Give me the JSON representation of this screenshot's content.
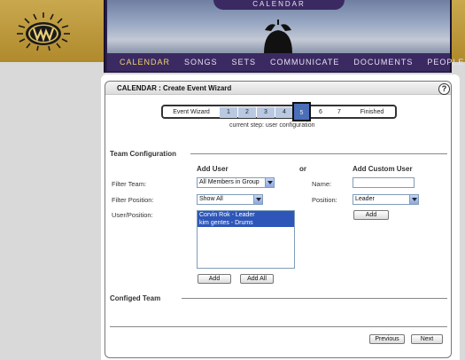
{
  "header": {
    "banner_title": "CALENDAR",
    "nav": [
      "CALENDAR",
      "SONGS",
      "SETS",
      "COMMUNICATE",
      "DOCUMENTS",
      "PEOPLE"
    ],
    "active_nav": "CALENDAR",
    "logo_icon": "w-sunburst-logo-icon",
    "clock_icon": "alarm-clock-icon"
  },
  "wizard": {
    "title": "CALENDAR : Create Event Wizard",
    "help": "?",
    "steps_label": "Event Wizard",
    "steps": [
      "1",
      "2",
      "3",
      "4",
      "5",
      "6",
      "7"
    ],
    "current_step_number": "5",
    "finished": "Finished",
    "current_step_text": "current step: user configuration"
  },
  "team_config": {
    "title": "Team Configuration",
    "add_user_head": "Add User",
    "or": "or",
    "add_custom_head": "Add Custom User",
    "filter_team_label": "Filter Team:",
    "filter_team_value": "All Members in Group",
    "filter_position_label": "Filter Position:",
    "filter_position_value": "Show All",
    "user_position_label": "User/Position:",
    "users": [
      "Corvin Rok - Leader",
      "kim gentes - Drums"
    ],
    "name_label": "Name:",
    "name_value": "",
    "position_label": "Position:",
    "position_value": "Leader",
    "add_custom_button": "Add",
    "add_button": "Add",
    "add_all_button": "Add All"
  },
  "configed_team": {
    "title": "Configed Team"
  },
  "footer": {
    "previous": "Previous",
    "next": "Next"
  },
  "colors": {
    "gold": "#c9a84e",
    "purple_nav": "#3b2a62",
    "active_nav": "#f2d36a",
    "step_current": "#4a6fb8",
    "list_selection": "#2e56b8"
  }
}
